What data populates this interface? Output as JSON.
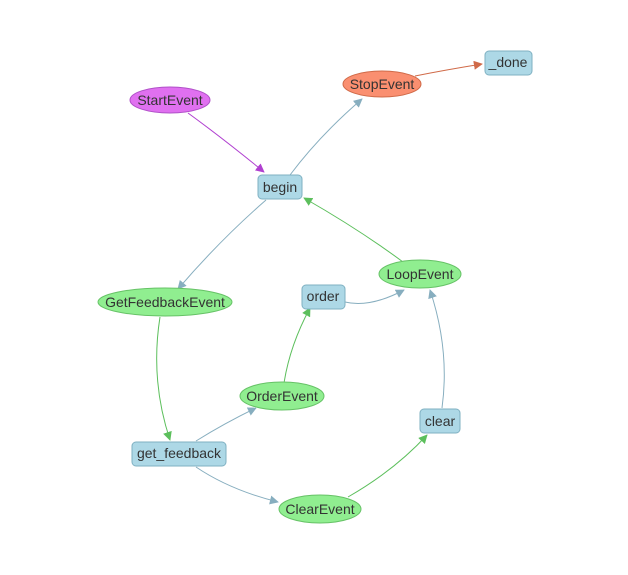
{
  "diagram": {
    "type": "workflow-graph",
    "colors": {
      "step_fill": "#add8e6",
      "step_stroke": "#7fb1c2",
      "event_green_fill": "#90ee90",
      "event_green_stroke": "#66c266",
      "start_fill": "#e070f0",
      "start_stroke": "#b050c8",
      "stop_fill": "#fa8f70",
      "stop_stroke": "#d06a48",
      "edge_blue": "#87aebf",
      "edge_green": "#5cbf5c",
      "edge_purple": "#b040d0",
      "edge_orange": "#d06a48"
    },
    "nodes": [
      {
        "id": "StartEvent",
        "label": "StartEvent",
        "shape": "ellipse",
        "kind": "start"
      },
      {
        "id": "StopEvent",
        "label": "StopEvent",
        "shape": "ellipse",
        "kind": "stop"
      },
      {
        "id": "_done",
        "label": "_done",
        "shape": "box",
        "kind": "step"
      },
      {
        "id": "begin",
        "label": "begin",
        "shape": "box",
        "kind": "step"
      },
      {
        "id": "GetFeedbackEvent",
        "label": "GetFeedbackEvent",
        "shape": "ellipse",
        "kind": "event"
      },
      {
        "id": "LoopEvent",
        "label": "LoopEvent",
        "shape": "ellipse",
        "kind": "event"
      },
      {
        "id": "order",
        "label": "order",
        "shape": "box",
        "kind": "step"
      },
      {
        "id": "OrderEvent",
        "label": "OrderEvent",
        "shape": "ellipse",
        "kind": "event"
      },
      {
        "id": "clear",
        "label": "clear",
        "shape": "box",
        "kind": "step"
      },
      {
        "id": "get_feedback",
        "label": "get_feedback",
        "shape": "box",
        "kind": "step"
      },
      {
        "id": "ClearEvent",
        "label": "ClearEvent",
        "shape": "ellipse",
        "kind": "event"
      }
    ],
    "edges": [
      {
        "from": "StartEvent",
        "to": "begin",
        "color": "purple"
      },
      {
        "from": "begin",
        "to": "StopEvent",
        "color": "blue"
      },
      {
        "from": "StopEvent",
        "to": "_done",
        "color": "orange"
      },
      {
        "from": "begin",
        "to": "GetFeedbackEvent",
        "color": "blue"
      },
      {
        "from": "LoopEvent",
        "to": "begin",
        "color": "green"
      },
      {
        "from": "GetFeedbackEvent",
        "to": "get_feedback",
        "color": "green"
      },
      {
        "from": "get_feedback",
        "to": "OrderEvent",
        "color": "blue"
      },
      {
        "from": "get_feedback",
        "to": "ClearEvent",
        "color": "blue"
      },
      {
        "from": "OrderEvent",
        "to": "order",
        "color": "green"
      },
      {
        "from": "order",
        "to": "LoopEvent",
        "color": "blue"
      },
      {
        "from": "ClearEvent",
        "to": "clear",
        "color": "green"
      },
      {
        "from": "clear",
        "to": "LoopEvent",
        "color": "blue"
      }
    ]
  }
}
